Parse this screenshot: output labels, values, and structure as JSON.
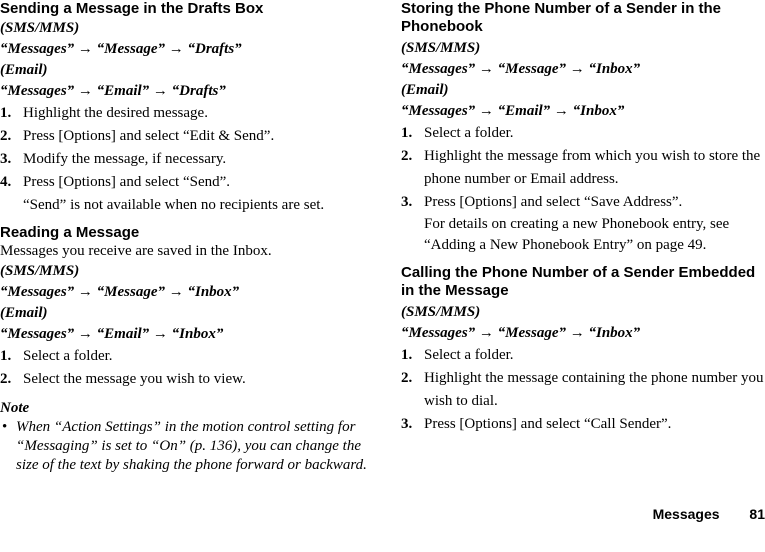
{
  "left": {
    "section1": {
      "title": "Sending a Message in the Drafts Box",
      "sms_label": "(SMS/MMS)",
      "sms_path": "“Messages” → “Message” → “Drafts”",
      "email_label": "(Email)",
      "email_path": "“Messages” → “Email” → “Drafts”",
      "steps": [
        {
          "num": "1.",
          "text": "Highlight the desired message."
        },
        {
          "num": "2.",
          "text": "Press [Options] and select “Edit & Send”."
        },
        {
          "num": "3.",
          "text": "Modify the message, if necessary."
        },
        {
          "num": "4.",
          "text": "Press [Options] and select “Send”."
        }
      ],
      "step4_note": "“Send” is not available when no recipients are set."
    },
    "section2": {
      "title": "Reading a Message",
      "intro": "Messages you receive are saved in the Inbox.",
      "sms_label": "(SMS/MMS)",
      "sms_path": "“Messages” → “Message” → “Inbox”",
      "email_label": "(Email)",
      "email_path": "“Messages” → “Email” → “Inbox”",
      "steps": [
        {
          "num": "1.",
          "text": "Select a folder."
        },
        {
          "num": "2.",
          "text": "Select the message you wish to view."
        }
      ]
    },
    "note": {
      "title": "Note",
      "bullet": "•",
      "text": "When “Action Settings” in the motion control setting for “Messaging” is set to “On” (p. 136), you can change the size of the text by shaking the phone forward or backward."
    }
  },
  "right": {
    "section3": {
      "title": "Storing the Phone Number of a Sender in the Phonebook",
      "sms_label": "(SMS/MMS)",
      "sms_path": "“Messages” → “Message” → “Inbox”",
      "email_label": "(Email)",
      "email_path": "“Messages” → “Email” → “Inbox”",
      "steps": [
        {
          "num": "1.",
          "text": "Select a folder."
        },
        {
          "num": "2.",
          "text": "Highlight the message from which you wish to store the phone number or Email address."
        },
        {
          "num": "3.",
          "text": "Press [Options] and select “Save Address”."
        }
      ],
      "step3_note": "For details on creating a new Phonebook entry, see “Adding a New Phonebook Entry” on page 49."
    },
    "section4": {
      "title": "Calling the Phone Number of a Sender Embedded in the Message",
      "sms_label": "(SMS/MMS)",
      "sms_path": "“Messages” → “Message” → “Inbox”",
      "steps": [
        {
          "num": "1.",
          "text": "Select a folder."
        },
        {
          "num": "2.",
          "text": "Highlight the message containing the phone number you wish to dial."
        },
        {
          "num": "3.",
          "text": "Press [Options] and select “Call Sender”."
        }
      ]
    }
  },
  "footer": {
    "section_name": "Messages",
    "page_number": "81"
  }
}
